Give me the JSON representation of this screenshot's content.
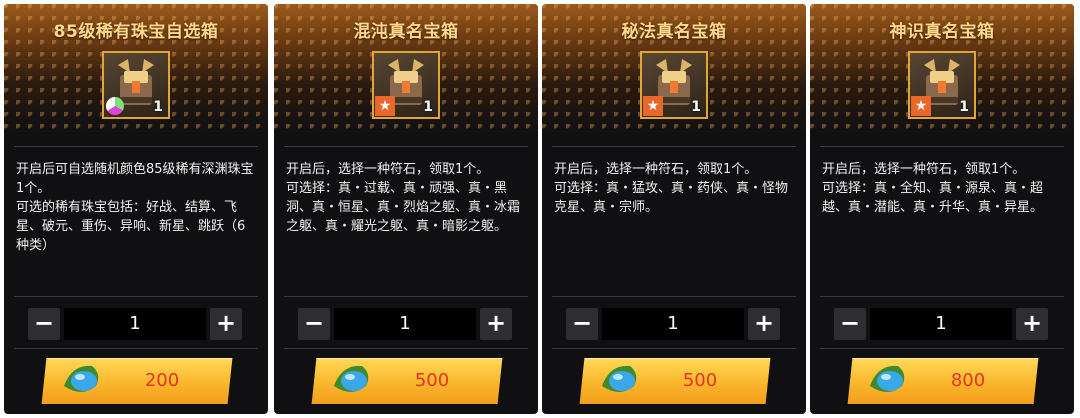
{
  "colors": {
    "title_gold": "#ffd88a",
    "item_border": "#e0a63a",
    "price_red": "#e8341c",
    "button_gold": "#f9b72c",
    "star_badge_orange": "#e8672a"
  },
  "icons": {
    "item": "treasure-chest-icon",
    "currency": "blue-gem-icon",
    "star_badge": "star-icon",
    "rarity_badge": "rainbow-gem-badge-icon"
  },
  "cards": [
    {
      "title": "85级稀有珠宝自选箱",
      "item_count": "1",
      "item_badge": "gem",
      "description": "开启后可自选随机颜色85级稀有深渊珠宝1个。\n可选的稀有珠宝包括：好战、结算、飞星、破元、重伤、异响、新星、跳跃（6种类）",
      "quantity": "1",
      "minus_label": "−",
      "plus_label": "+",
      "price": "200"
    },
    {
      "title": "混沌真名宝箱",
      "item_count": "1",
      "item_badge": "star",
      "description": "开启后，选择一种符石，领取1个。\n可选择：真・过载、真・顽强、真・黑洞、真・恒星、真・烈焰之躯、真・冰霜之躯、真・耀光之躯、真・暗影之躯。",
      "quantity": "1",
      "minus_label": "−",
      "plus_label": "+",
      "price": "500"
    },
    {
      "title": "秘法真名宝箱",
      "item_count": "1",
      "item_badge": "star",
      "description": "开启后，选择一种符石，领取1个。\n可选择：真・猛攻、真・药侠、真・怪物克星、真・宗师。",
      "quantity": "1",
      "minus_label": "−",
      "plus_label": "+",
      "price": "500"
    },
    {
      "title": "神识真名宝箱",
      "item_count": "1",
      "item_badge": "star",
      "description": "开启后，选择一种符石，领取1个。\n可选择：真・全知、真・源泉、真・超越、真・潜能、真・升华、真・异星。",
      "quantity": "1",
      "minus_label": "−",
      "plus_label": "+",
      "price": "800"
    }
  ]
}
